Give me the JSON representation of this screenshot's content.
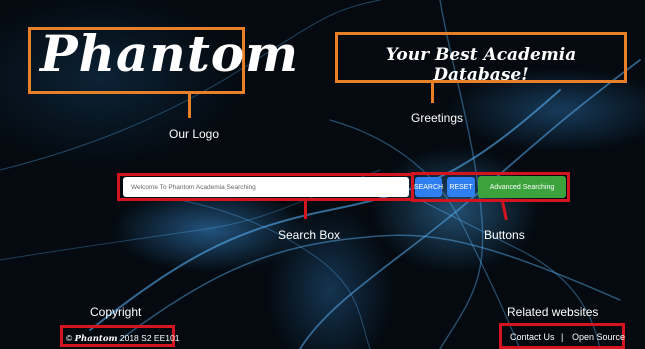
{
  "logo": {
    "text": "Phantom",
    "annotation": "Our Logo"
  },
  "greeting": {
    "text": "Your Best Academia Database!",
    "annotation": "Greetings"
  },
  "search": {
    "placeholder": "Welcome To Phantom Academia Searching",
    "annotation": "Search Box"
  },
  "buttons": {
    "search_label": "SEARCH",
    "reset_label": "RESET",
    "advanced_label": "Advanced Searching",
    "annotation": "Buttons"
  },
  "footer": {
    "copyright_annotation": "Copyright",
    "copyright_symbol": "©",
    "copyright_brand": "Phantom",
    "copyright_rest": "2018 S2 EE101",
    "related_annotation": "Related websites",
    "contact_label": "Contact Us",
    "separator": "|",
    "open_source_label": "Open Source"
  },
  "colors": {
    "annotation_orange": "#e8802a",
    "annotation_red": "#d4141f",
    "button_blue": "#2f7ff0",
    "button_green": "#3ca23c",
    "background": "#040a10"
  }
}
